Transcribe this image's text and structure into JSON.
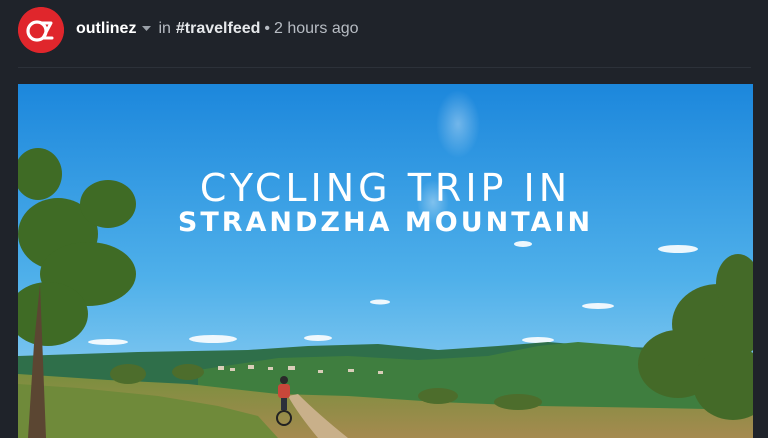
{
  "post": {
    "author": "outlinez",
    "in_label": "in",
    "community": "#travelfeed",
    "separator": "•",
    "time": "2 hours ago"
  },
  "hero": {
    "title_line1": "CYCLING TRIP IN",
    "title_line2": "STRANDZHA MOUNTAIN"
  },
  "icons": {
    "avatar": "avatar-logo",
    "caret": "caret-down-icon"
  },
  "colors": {
    "background": "#1f232a",
    "avatar": "#e0262c",
    "sky_top": "#1f8fe0",
    "sky_bottom": "#8fd0f4"
  }
}
